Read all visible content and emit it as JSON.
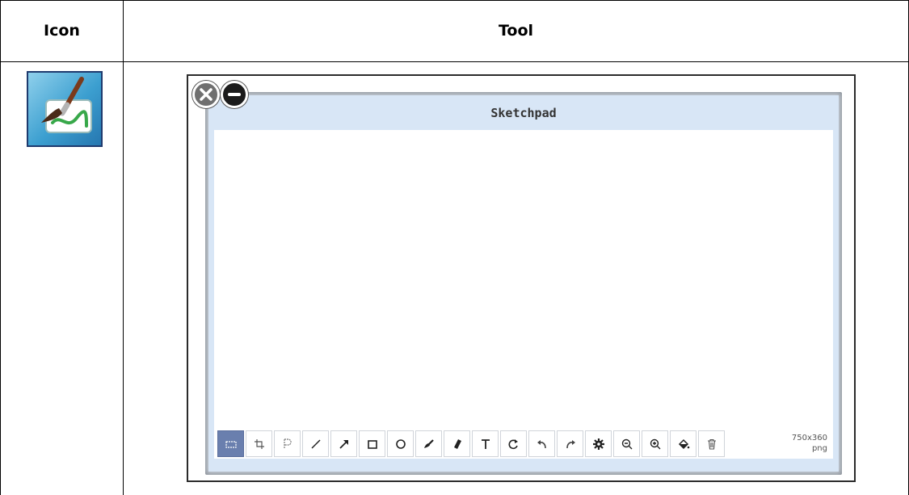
{
  "table": {
    "header_icon": "Icon",
    "header_tool": "Tool"
  },
  "icon_cell": {
    "icon": "sketchpad-paintbrush-icon"
  },
  "sketchpad": {
    "title": "Sketchpad",
    "window_buttons": [
      {
        "name": "close",
        "icon": "close-x-icon"
      },
      {
        "name": "minimize",
        "icon": "minus-icon"
      }
    ],
    "tools": [
      {
        "name": "select",
        "icon": "select-rect-icon",
        "active": true
      },
      {
        "name": "crop",
        "icon": "crop-icon",
        "active": false
      },
      {
        "name": "paste",
        "icon": "paste-icon",
        "active": false
      },
      {
        "name": "line",
        "icon": "line-icon",
        "active": false
      },
      {
        "name": "arrow",
        "icon": "arrow-icon",
        "active": false
      },
      {
        "name": "rectangle",
        "icon": "rectangle-icon",
        "active": false
      },
      {
        "name": "ellipse",
        "icon": "ellipse-icon",
        "active": false
      },
      {
        "name": "brush",
        "icon": "brush-icon",
        "active": false
      },
      {
        "name": "eraser",
        "icon": "eraser-icon",
        "active": false
      },
      {
        "name": "text",
        "icon": "text-icon",
        "active": false
      },
      {
        "name": "rotate",
        "icon": "rotate-icon",
        "active": false
      },
      {
        "name": "undo",
        "icon": "undo-icon",
        "active": false
      },
      {
        "name": "redo",
        "icon": "redo-icon",
        "active": false
      },
      {
        "name": "settings",
        "icon": "gear-icon",
        "active": false
      },
      {
        "name": "zoom-out",
        "icon": "zoom-out-icon",
        "active": false
      },
      {
        "name": "zoom-in",
        "icon": "zoom-in-icon",
        "active": false
      },
      {
        "name": "fill",
        "icon": "paint-bucket-icon",
        "active": false
      },
      {
        "name": "clear",
        "icon": "trash-icon",
        "active": false
      }
    ],
    "canvas_size": "750x360",
    "canvas_format": "png"
  },
  "colors": {
    "frame_bg": "#d8e6f6",
    "active_tool": "#6a7fae"
  }
}
